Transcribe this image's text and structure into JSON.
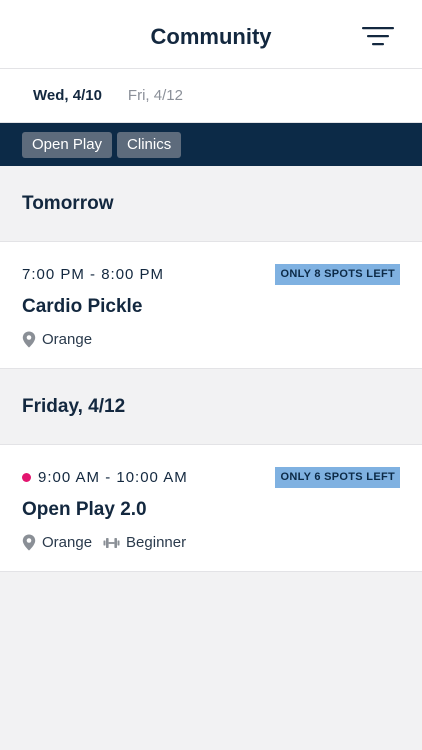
{
  "header": {
    "title": "Community",
    "filter_icon": "filter-lines-icon"
  },
  "date_tabs": [
    {
      "label": "Wed, 4/10",
      "active": true
    },
    {
      "label": "Fri, 4/12",
      "active": false
    }
  ],
  "chips": [
    {
      "label": "Open Play"
    },
    {
      "label": "Clinics"
    }
  ],
  "sections": [
    {
      "heading": "Tomorrow",
      "events": [
        {
          "time": "7:00 PM - 8:00 PM",
          "title": "Cardio Pickle",
          "badge": "ONLY 8 SPOTS LEFT",
          "location": "Orange",
          "live": false
        }
      ]
    },
    {
      "heading": "Friday, 4/12",
      "events": [
        {
          "time": "9:00 AM - 10:00 AM",
          "title": "Open Play 2.0",
          "badge": "ONLY 6 SPOTS LEFT",
          "location": "Orange",
          "level": "Beginner",
          "live": true
        }
      ]
    }
  ],
  "colors": {
    "navy": "#0c2a47",
    "badge": "#7fb1e1",
    "live_dot": "#e3156f",
    "background": "#f2f2f3"
  }
}
